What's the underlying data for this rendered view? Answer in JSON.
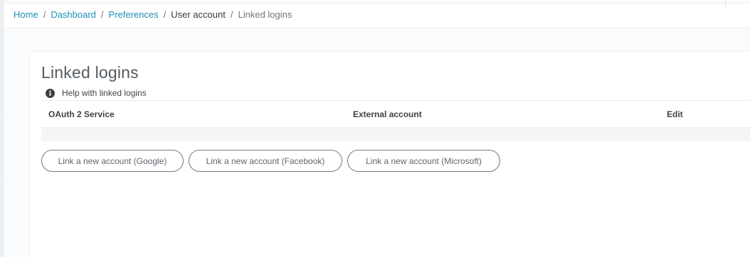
{
  "breadcrumb": {
    "home": "Home",
    "dashboard": "Dashboard",
    "preferences": "Preferences",
    "user_account": "User account",
    "current": "Linked logins",
    "separator": "/"
  },
  "page": {
    "title": "Linked logins",
    "help_text": "Help with linked logins",
    "help_icon": "info-circle-icon"
  },
  "table": {
    "columns": [
      "OAuth 2 Service",
      "External account",
      "Edit"
    ],
    "rows": []
  },
  "actions": {
    "link_google": "Link a new account (Google)",
    "link_facebook": "Link a new account (Facebook)",
    "link_microsoft": "Link a new account (Microsoft)"
  },
  "colors": {
    "link": "#1a8fb5",
    "title": "#555b61",
    "button_border": "#707a82",
    "empty_row": "#f4f5f6"
  }
}
